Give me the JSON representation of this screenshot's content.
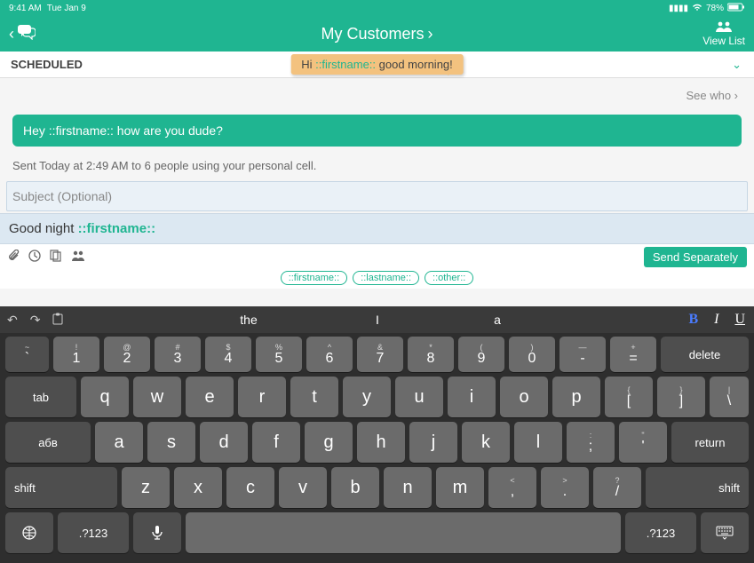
{
  "status": {
    "time": "9:41 AM",
    "date": "Tue Jan 9",
    "battery": "78%"
  },
  "header": {
    "title": "My Customers",
    "viewList": "View List"
  },
  "scheduled": {
    "label": "SCHEDULED",
    "bubblePrefix": "Hi ",
    "bubblePlaceholder": "::firstname::",
    "bubbleSuffix": " good morning!",
    "seeWho": "See who ›"
  },
  "message": {
    "text": "Hey ::firstname:: how are you dude?"
  },
  "sentInfo": "Sent Today at 2:49 AM to 6 people using your personal cell.",
  "compose": {
    "subjectPlaceholder": "Subject (Optional)",
    "bodyPrefix": "Good night ",
    "bodyPlaceholder": "::firstname::"
  },
  "sendButton": "Send Separately",
  "pills": {
    "first": "::firstname::",
    "last": "::lastname::",
    "other": "::other::"
  },
  "kb": {
    "sugg": {
      "a": "the",
      "b": "I",
      "c": "a"
    },
    "row1": {
      "tilde": {
        "s": "~",
        "m": "`"
      },
      "n1": {
        "s": "!",
        "m": "1"
      },
      "n2": {
        "s": "@",
        "m": "2"
      },
      "n3": {
        "s": "#",
        "m": "3"
      },
      "n4": {
        "s": "$",
        "m": "4"
      },
      "n5": {
        "s": "%",
        "m": "5"
      },
      "n6": {
        "s": "^",
        "m": "6"
      },
      "n7": {
        "s": "&",
        "m": "7"
      },
      "n8": {
        "s": "*",
        "m": "8"
      },
      "n9": {
        "s": "(",
        "m": "9"
      },
      "n0": {
        "s": ")",
        "m": "0"
      },
      "dash": {
        "s": "—",
        "m": "-"
      },
      "plus": {
        "s": "+",
        "m": "="
      },
      "delete": "delete"
    },
    "row2": {
      "tab": "tab",
      "q": "q",
      "w": "w",
      "e": "e",
      "r": "r",
      "t": "t",
      "y": "y",
      "u": "u",
      "i": "i",
      "o": "o",
      "p": "p",
      "lb": {
        "s": "{",
        "m": "["
      },
      "rb": {
        "s": "}",
        "m": "]"
      },
      "bs": {
        "s": "|",
        "m": "\\"
      }
    },
    "row3": {
      "abc": "абв",
      "a": "a",
      "s": "s",
      "d": "d",
      "f": "f",
      "g": "g",
      "h": "h",
      "j": "j",
      "k": "k",
      "l": "l",
      "semi": {
        "s": ":",
        "m": ";"
      },
      "quote": {
        "s": "\"",
        "m": "'"
      },
      "return": "return"
    },
    "row4": {
      "shiftL": "shift",
      "z": "z",
      "x": "x",
      "c": "c",
      "v": "v",
      "b": "b",
      "n": "n",
      "m": "m",
      "lt": {
        "s": "<",
        "m": ","
      },
      "gt": {
        "s": ">",
        "m": "."
      },
      "q": {
        "s": "?",
        "m": "/"
      },
      "shiftR": "shift"
    },
    "row5": {
      "numL": ".?123",
      "numR": ".?123"
    }
  }
}
